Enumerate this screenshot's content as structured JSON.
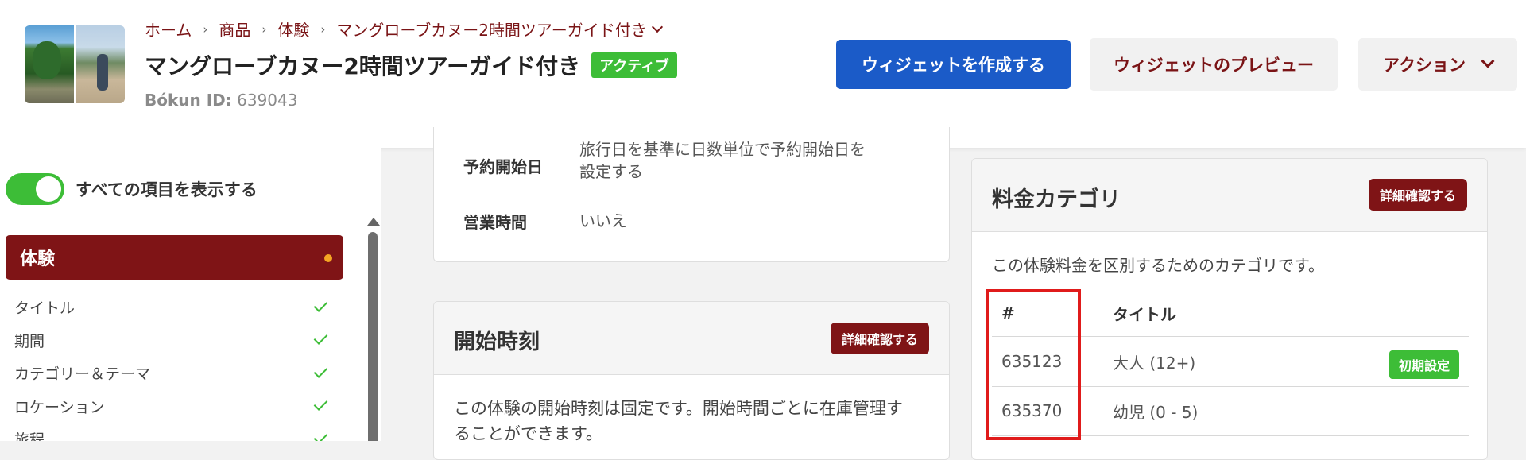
{
  "breadcrumb": {
    "items": [
      "ホーム",
      "商品",
      "体験"
    ],
    "current": "マングローブカヌー2時間ツアーガイド付き"
  },
  "product": {
    "title": "マングローブカヌー2時間ツアーガイド付き",
    "status": "アクティブ",
    "id_label": "Bókun ID:",
    "id_value": "639043"
  },
  "header_buttons": {
    "create_widget": "ウィジェットを作成する",
    "preview_widget": "ウィジェットのプレビュー",
    "actions": "アクション"
  },
  "sidebar": {
    "toggle_label": "すべての項目を表示する",
    "section": "体験",
    "items": [
      {
        "label": "タイトル"
      },
      {
        "label": "期間"
      },
      {
        "label": "カテゴリー＆テーマ"
      },
      {
        "label": "ロケーション"
      },
      {
        "label": "旅程"
      }
    ]
  },
  "booking_info": {
    "rows": [
      {
        "label": "予約開始日",
        "value_line1": "旅行日を基準に日数単位で予約開始日を",
        "value_line2": "設定する"
      },
      {
        "label": "営業時間",
        "value_line1": "いいえ"
      }
    ]
  },
  "start_time_card": {
    "title": "開始時刻",
    "detail_button": "詳細確認する",
    "description_line1": "この体験の開始時刻は固定です。開始時間ごとに在庫管理す",
    "description_line2": "ることができます。"
  },
  "price_card": {
    "title": "料金カテゴリ",
    "detail_button": "詳細確認する",
    "description": "この体験料金を区別するためのカテゴリです。",
    "columns": [
      "#",
      "タイトル"
    ],
    "rows": [
      {
        "id": "635123",
        "title": "大人 (12+)",
        "badge": "初期設定"
      },
      {
        "id": "635370",
        "title": "幼児 (0 - 5)"
      }
    ]
  },
  "colors": {
    "brand": "#7f1416",
    "primary_button": "#1b5bc8",
    "success": "#3dbd37",
    "highlight": "#e01b1b"
  }
}
